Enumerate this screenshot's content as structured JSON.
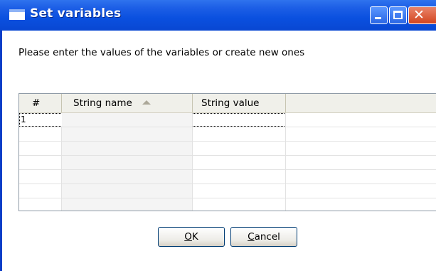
{
  "window": {
    "title": "Set variables",
    "controls": {
      "minimize": "minimize",
      "maximize": "maximize",
      "close": "close"
    }
  },
  "prompt": "Please enter the values of the variables or create new ones",
  "table": {
    "columns": [
      {
        "label": "#"
      },
      {
        "label": "String name",
        "sort": "ascending"
      },
      {
        "label": "String value"
      },
      {
        "label": ""
      }
    ],
    "rows": [
      {
        "num": "1",
        "name": "",
        "value": ""
      },
      {
        "num": "",
        "name": "",
        "value": ""
      },
      {
        "num": "",
        "name": "",
        "value": ""
      },
      {
        "num": "",
        "name": "",
        "value": ""
      },
      {
        "num": "",
        "name": "",
        "value": ""
      },
      {
        "num": "",
        "name": "",
        "value": ""
      },
      {
        "num": "",
        "name": "",
        "value": ""
      }
    ]
  },
  "buttons": {
    "ok": {
      "mnemonic": "O",
      "rest": "K"
    },
    "cancel": {
      "mnemonic": "C",
      "rest": "ancel"
    }
  },
  "colors": {
    "titlebar": "#0a50df",
    "close_button": "#d3451f",
    "header_bg": "#f0f0ea"
  }
}
